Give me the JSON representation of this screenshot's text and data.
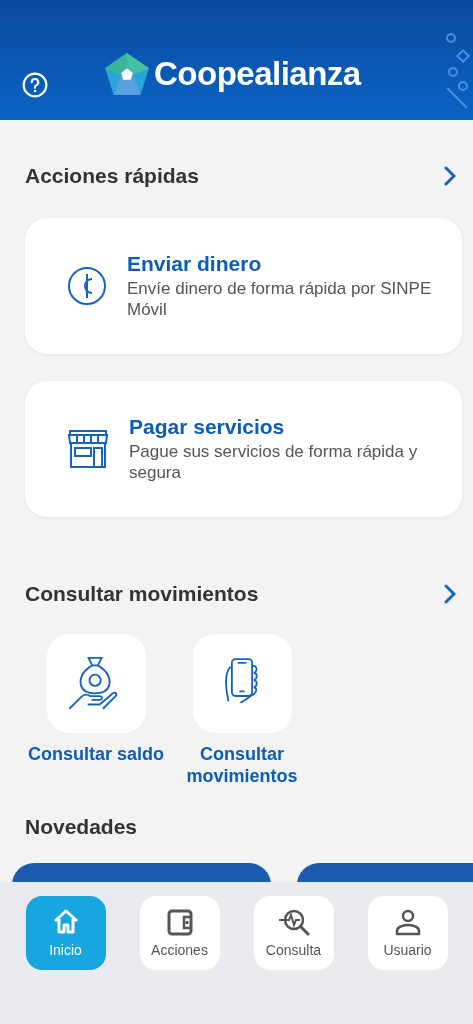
{
  "header": {
    "logo_text": "Coopealianza"
  },
  "quick_actions": {
    "title": "Acciones rápidas",
    "items": [
      {
        "kind": "money",
        "title": "Enviar dinero",
        "description": "Envíe dinero de forma rápida por SINPE Móvil"
      },
      {
        "kind": "store",
        "title": "Pagar servicios",
        "description": "Pague sus servicios de forma rápida y segura"
      }
    ]
  },
  "movements": {
    "title": "Consultar movimientos",
    "items": [
      {
        "kind": "bag",
        "label": "Consultar saldo"
      },
      {
        "kind": "phone",
        "label": "Consultar movimientos"
      }
    ]
  },
  "news": {
    "title": "Novedades"
  },
  "bottom_nav": [
    {
      "kind": "home",
      "label": "Inicio",
      "selected": true
    },
    {
      "kind": "wallet",
      "label": "Acciones",
      "selected": false
    },
    {
      "kind": "search",
      "label": "Consulta",
      "selected": false
    },
    {
      "kind": "user",
      "label": "Usuario",
      "selected": false
    }
  ]
}
